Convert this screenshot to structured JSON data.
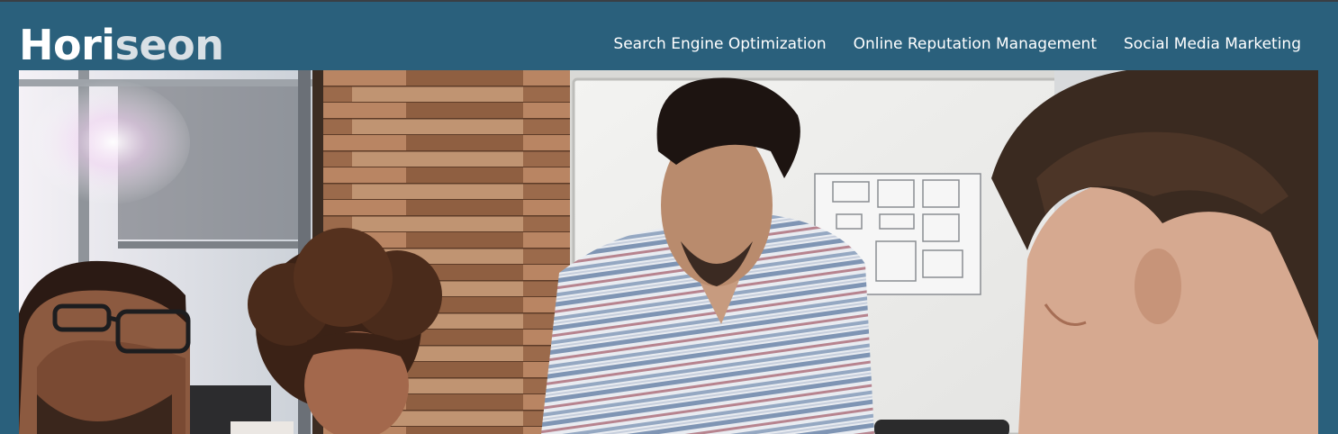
{
  "header": {
    "logo": {
      "part1": "Hori",
      "part2": "seon"
    },
    "nav": [
      {
        "label": "Search Engine Optimization"
      },
      {
        "label": "Online Reputation Management"
      },
      {
        "label": "Social Media Marketing"
      }
    ]
  },
  "hero": {
    "image": "team-meeting-photo",
    "colors": {
      "header_bg": "#2a607c",
      "nav_text": "#ffffff"
    }
  }
}
